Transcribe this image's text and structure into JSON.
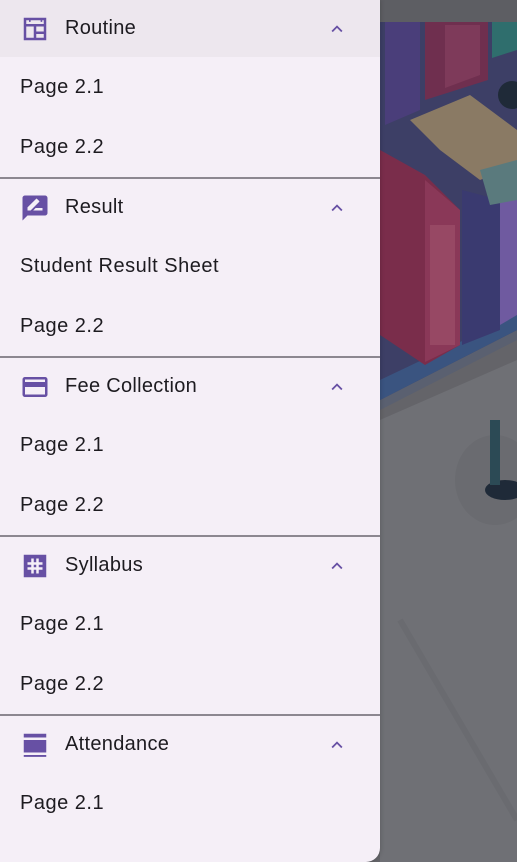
{
  "colors": {
    "accent": "#6750a4",
    "drawer_bg": "#f5eff7",
    "active_header_bg": "#ede7ee",
    "text": "#1d1b20",
    "divider": "#79747e"
  },
  "drawer": {
    "sections": [
      {
        "label": "Routine",
        "icon": "calendar-view-icon",
        "expanded": true,
        "items": [
          "Page 2.1",
          "Page 2.2"
        ]
      },
      {
        "label": "Result",
        "icon": "rate-review-icon",
        "expanded": true,
        "items": [
          "Student Result Sheet",
          "Page 2.2"
        ]
      },
      {
        "label": "Fee Collection",
        "icon": "credit-card-icon",
        "expanded": true,
        "items": [
          "Page 2.1",
          "Page 2.2"
        ]
      },
      {
        "label": "Syllabus",
        "icon": "syllabus-icon",
        "expanded": true,
        "items": [
          "Page 2.1",
          "Page 2.2"
        ]
      },
      {
        "label": "Attendance",
        "icon": "view-agenda-icon",
        "expanded": true,
        "items": [
          "Page 2.1"
        ]
      }
    ]
  }
}
